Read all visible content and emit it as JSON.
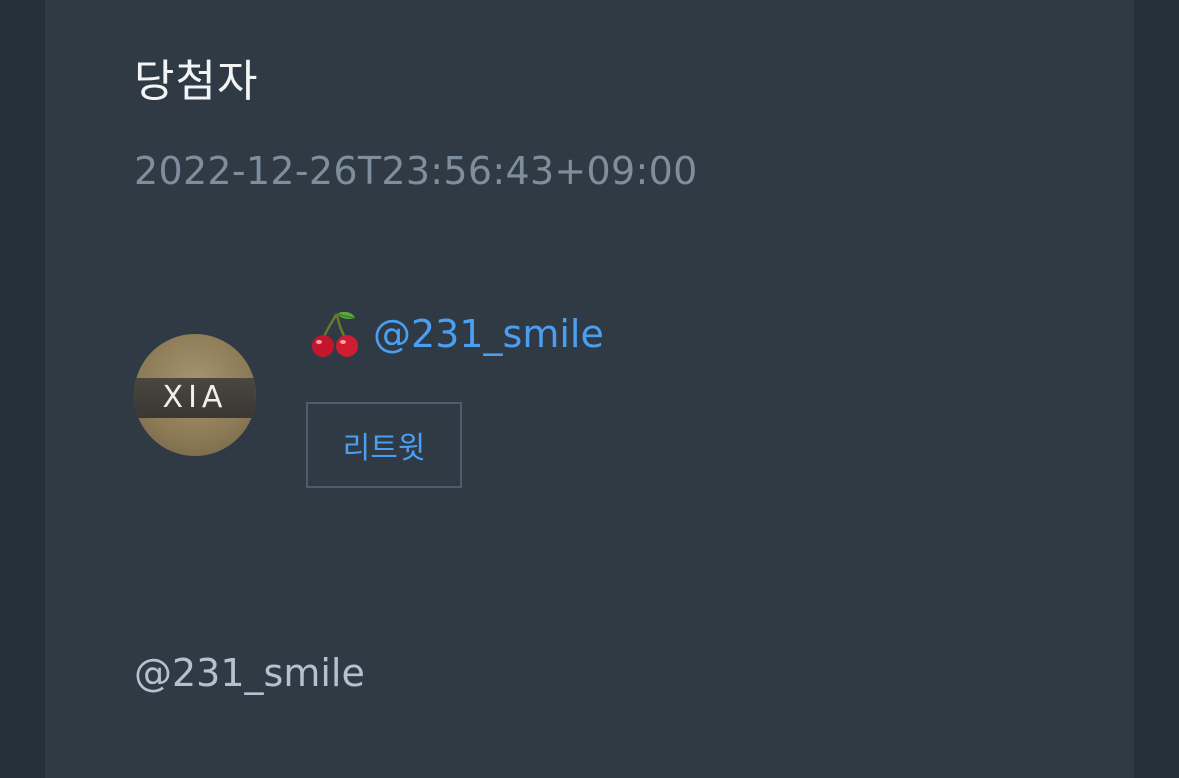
{
  "post": {
    "title": "당첨자",
    "timestamp": "2022-12-26T23:56:43+09:00"
  },
  "winner": {
    "avatar_text": "XIA",
    "emoji_icon": "cherry-icon",
    "handle": "@231_smile",
    "retweet_label": "리트윗"
  },
  "footer": {
    "handle": "@231_smile"
  },
  "colors": {
    "panel_bg": "#2f3a45",
    "outer_bg": "#25303a",
    "link": "#4a9ff0",
    "muted": "#7e8e9d"
  }
}
